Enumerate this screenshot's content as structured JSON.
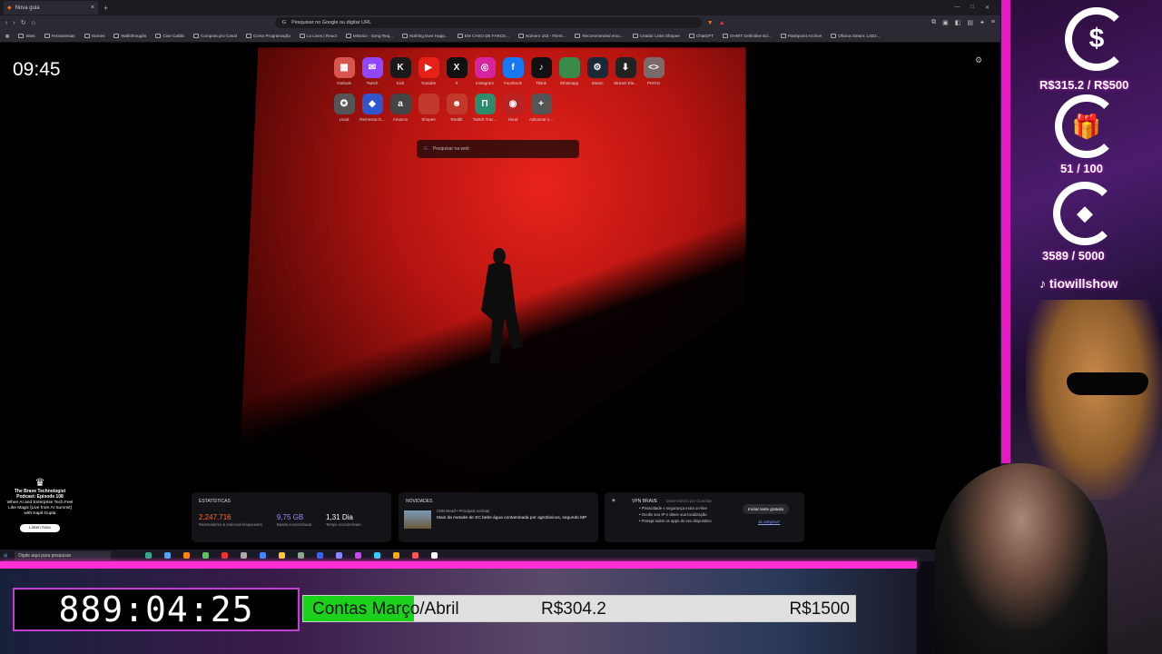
{
  "browser": {
    "tab_title": "Nova guia",
    "url_placeholder": "Pesquisar no Google ou digitar URL",
    "bookmarks": [
      "Sites",
      "Ferramentas",
      "Games",
      "Walkthroughs",
      "Cine Cabilo",
      "Compras pro Canal",
      "Curso Programação",
      "Lu Lives | React",
      "MissXix - Song Req...",
      "Nothing Ever Happ...",
      "EM CASO DE FARCE...",
      "Número 153 - Filent...",
      "Recommended emu...",
      "Criador Links Shopee",
      "ChatGPT",
      "GHWT: Definitive Ed...",
      "Flashpoint Archive",
      "Oficina Steam::L4D2..."
    ]
  },
  "newtab": {
    "clock": "09:45",
    "search_placeholder": "Pesquisar na web",
    "tiles_row1": [
      {
        "label": "Outlook",
        "icon": "outlook-icon",
        "color": "#d9534f",
        "glyph": "▦"
      },
      {
        "label": "Twitch",
        "icon": "twitch-icon",
        "color": "#9146ff",
        "glyph": "✉"
      },
      {
        "label": "Kick",
        "icon": "kick-icon",
        "color": "#1a1a1a",
        "glyph": "K"
      },
      {
        "label": "Youtube",
        "icon": "youtube-icon",
        "color": "#e62117",
        "glyph": "▶"
      },
      {
        "label": "X",
        "icon": "x-icon",
        "color": "#111",
        "glyph": "X"
      },
      {
        "label": "Instagram",
        "icon": "instagram-icon",
        "color": "#d6249f",
        "glyph": "◎"
      },
      {
        "label": "Facebook",
        "icon": "facebook-icon",
        "color": "#1877f2",
        "glyph": "f"
      },
      {
        "label": "Tiktok",
        "icon": "tiktok-icon",
        "color": "#111",
        "glyph": "♪"
      },
      {
        "label": "Whatsapp",
        "icon": "whatsapp-icon",
        "color": "#3a8a4a",
        "glyph": ""
      },
      {
        "label": "Steam",
        "icon": "steam-icon",
        "color": "#1b2838",
        "glyph": "⚙"
      },
      {
        "label": "Stream Ele...",
        "icon": "streamelements-icon",
        "color": "#222",
        "glyph": "⬇"
      },
      {
        "label": "PIXGG",
        "icon": "pixgg-icon",
        "color": "#7a6a6a",
        "glyph": "<>"
      }
    ],
    "tiles_row2": [
      {
        "label": "Livad",
        "icon": "livad-icon",
        "color": "#555",
        "glyph": "✪"
      },
      {
        "label": "Remessa O...",
        "icon": "remessa-icon",
        "color": "#3355cc",
        "glyph": "◆"
      },
      {
        "label": "Amazon",
        "icon": "amazon-icon",
        "color": "#444",
        "glyph": "a"
      },
      {
        "label": "Shopee",
        "icon": "shopee-icon",
        "color": "#c0392b",
        "glyph": ""
      },
      {
        "label": "Reddit",
        "icon": "reddit-icon",
        "color": "#c0392b",
        "glyph": "☻"
      },
      {
        "label": "Twitch Trac...",
        "icon": "twitchtracker-icon",
        "color": "#2e8b6b",
        "glyph": "Π"
      },
      {
        "label": "Hood",
        "icon": "hood-icon",
        "color": "#b22",
        "glyph": "◉"
      },
      {
        "label": "Adicionar s...",
        "icon": "plus-icon",
        "color": "#555",
        "glyph": "+"
      }
    ],
    "podcast": {
      "title": "The Brave Technologist Podcast: Episode 108",
      "desc": "When AI and Enterprise Tech Feel Like Magic [Live from AI Summit] with Kapil Gupta",
      "button": "Listen Now"
    },
    "stats": {
      "header": "ESTATÍSTICAS",
      "items": [
        {
          "value": "2.247.716",
          "label": "Rastreadores & anúncios bloqueados",
          "color": "#ff6a3a"
        },
        {
          "value": "9,75 GB",
          "label": "Banda economizada",
          "color": "#9a8aff"
        },
        {
          "value": "1,31 Dia",
          "label": "Tempo economizado",
          "color": "#ffffff"
        }
      ]
    },
    "news": {
      "header": "NOVIDADES",
      "source": "CNN Brasil • Principais notícias",
      "headline": "Mais da metade de SC bebe água contaminada por agrotóxicos, segundo MP"
    },
    "vpn": {
      "header": "VPN BRAVE",
      "powered": "Desenvolvido por Guardian",
      "items": [
        "Privacidade e segurança extra on-line",
        "Oculte seu IP e altere sua localização",
        "Proteja todos os apps do seu dispositivo"
      ],
      "button": "Iniciar teste gratuito",
      "link": "Já comprou?"
    },
    "taskbar_search": "Digite aqui para pesquisar"
  },
  "overlay": {
    "money": "R$315.2 / R$500",
    "subs": "51 / 100",
    "xp": "3589 / 5000",
    "handle": "tiowillshow"
  },
  "stream_bar": {
    "timer": "889:04:25",
    "goal_label": "Contas Março/Abril",
    "goal_current": "R$304.2",
    "goal_target": "R$1500",
    "goal_progress": 0.2
  }
}
